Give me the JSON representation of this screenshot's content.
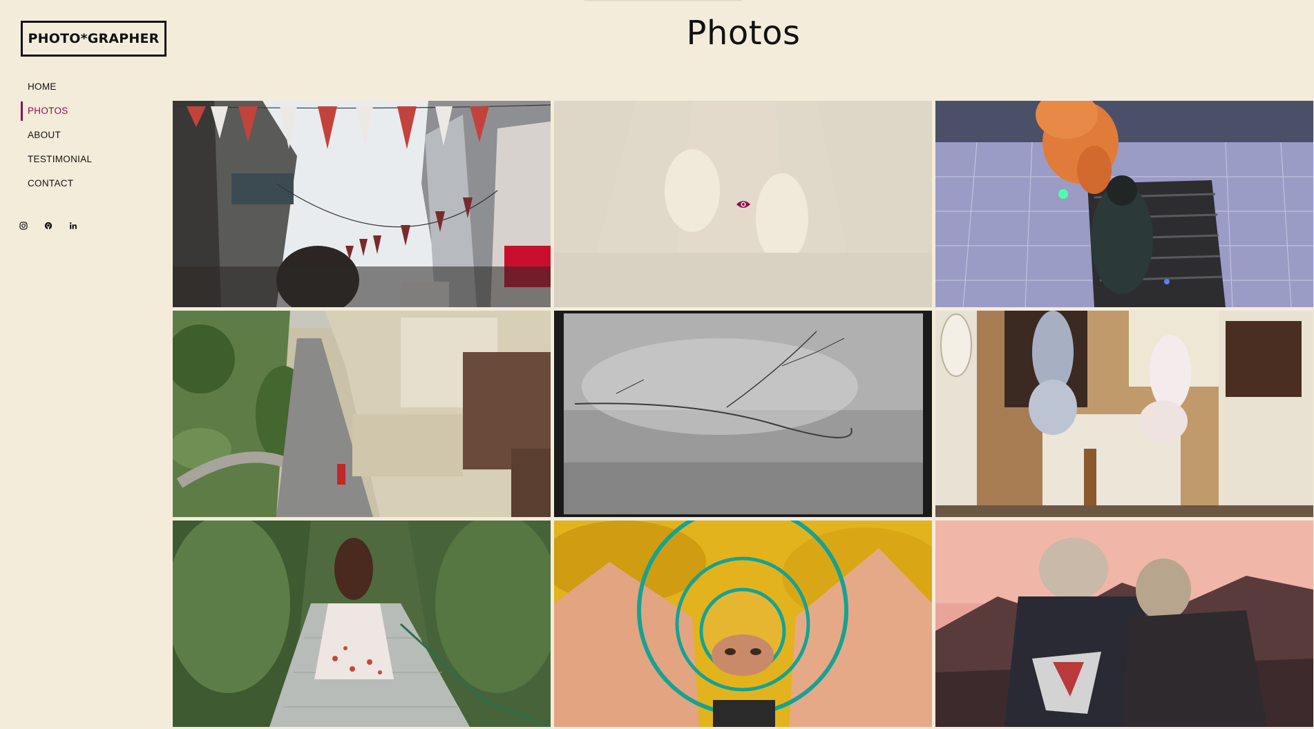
{
  "brand": {
    "logo_text": "PHOTO*GRAPHER"
  },
  "nav": {
    "items": [
      {
        "label": "HOME",
        "active": false
      },
      {
        "label": "PHOTOS",
        "active": true
      },
      {
        "label": "ABOUT",
        "active": false
      },
      {
        "label": "TESTIMONIAL",
        "active": false
      },
      {
        "label": "CONTACT",
        "active": false
      }
    ]
  },
  "social": [
    {
      "icon": "instagram-icon"
    },
    {
      "icon": "github-icon"
    },
    {
      "icon": "linkedin-icon"
    }
  ],
  "header": {
    "title": "Photos"
  },
  "colors": {
    "background": "#f4ecdb",
    "accent": "#8a1053",
    "text": "#111111"
  },
  "gallery": {
    "photos": [
      {
        "subject": "street-banners",
        "hovered": false
      },
      {
        "subject": "feet-over-street",
        "hovered": true,
        "hover_icon": "eye-icon"
      },
      {
        "subject": "smoke-flare-rooftop",
        "hovered": false
      },
      {
        "subject": "aerial-city-avenue",
        "hovered": false
      },
      {
        "subject": "branch-in-fog",
        "hovered": false
      },
      {
        "subject": "two-girls-jumping",
        "hovered": false
      },
      {
        "subject": "girl-on-garden-path",
        "hovered": false
      },
      {
        "subject": "hands-framing-eyes",
        "hovered": false
      },
      {
        "subject": "couple-at-sunset",
        "hovered": false
      }
    ]
  }
}
